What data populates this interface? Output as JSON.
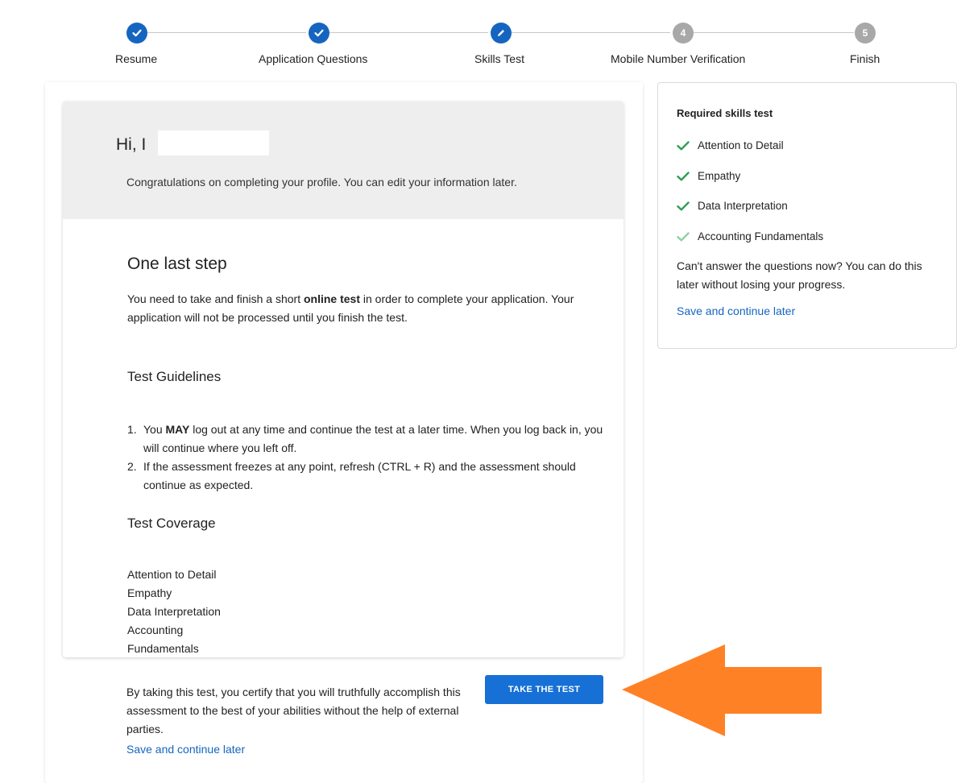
{
  "stepper": {
    "steps": [
      {
        "label": "Resume",
        "status": "done",
        "number": ""
      },
      {
        "label": "Application Questions",
        "status": "done",
        "number": ""
      },
      {
        "label": "Skills Test",
        "status": "current",
        "number": ""
      },
      {
        "label": "Mobile Number Verification",
        "status": "todo",
        "number": "4"
      },
      {
        "label": "Finish",
        "status": "todo",
        "number": "5"
      }
    ]
  },
  "greeting": {
    "title": "Hi, I",
    "subtitle": "Congratulations on completing your profile. You can edit your information later."
  },
  "last_step": {
    "title": "One last step",
    "text_before": "You need to take and finish a short ",
    "text_bold": "online test",
    "text_after": " in order to complete your application. Your application will not be processed until you finish the test."
  },
  "guidelines": {
    "title": "Test Guidelines",
    "item1_num": "1.",
    "item1_before": "You ",
    "item1_bold": "MAY",
    "item1_after": " log out at any time and continue the test at a later time. When you log back in, you will continue where you left off.",
    "item2_num": "2.",
    "item2_text": "If the assessment freezes at any point, refresh (CTRL + R) and the assessment should continue as expected."
  },
  "coverage": {
    "title": "Test Coverage",
    "items": [
      "Attention to Detail",
      "Empathy",
      "Data Interpretation",
      "Accounting",
      "Fundamentals"
    ]
  },
  "certify": {
    "text": "By taking this test, you certify that you will truthfully accomplish this assessment to the best of your abilities without the help of external parties.",
    "button_label": "TAKE THE TEST",
    "save_later": "Save and continue later"
  },
  "sidebar": {
    "title": "Required skills test",
    "skills": [
      {
        "label": "Attention to Detail",
        "check_color": "#2e9e4f"
      },
      {
        "label": "Empathy",
        "check_color": "#2e9e4f"
      },
      {
        "label": "Data Interpretation",
        "check_color": "#2e9e4f"
      },
      {
        "label": "Accounting Fundamentals",
        "check_color": "#8fd1a0"
      }
    ],
    "note": "Can't answer the questions now? You can do this later without losing your progress.",
    "save_later": "Save and continue later"
  },
  "colors": {
    "primary": "#1565c0",
    "button": "#1670d6",
    "step_todo": "#a8a8a8",
    "arrow": "#ff8126"
  },
  "icons": {
    "step_done": "check-icon",
    "step_current": "pencil-icon",
    "skill": "check-icon",
    "annotation": "left-arrow"
  }
}
